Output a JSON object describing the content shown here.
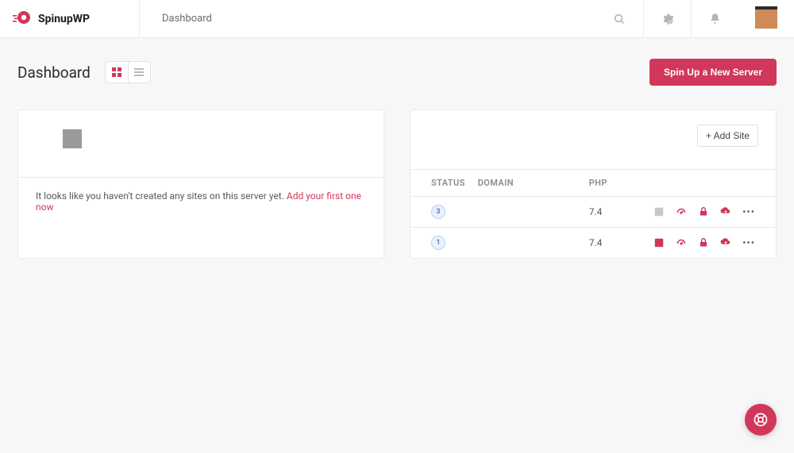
{
  "brand": {
    "name": "SpinupWP"
  },
  "breadcrumb": "Dashboard",
  "page": {
    "title": "Dashboard",
    "spin_button": "Spin Up a New Server"
  },
  "card_empty": {
    "message_prefix": "It looks like you haven't created any sites on this server yet. ",
    "link_text": "Add your first one now"
  },
  "card_sites": {
    "add_site_label": "+ Add Site",
    "columns": {
      "status": "STATUS",
      "domain": "DOMAIN",
      "php": "PHP"
    },
    "rows": [
      {
        "status": "3",
        "domain": "",
        "php": "7.4",
        "git_active": false
      },
      {
        "status": "1",
        "domain": "",
        "php": "7.4",
        "git_active": true
      }
    ]
  }
}
